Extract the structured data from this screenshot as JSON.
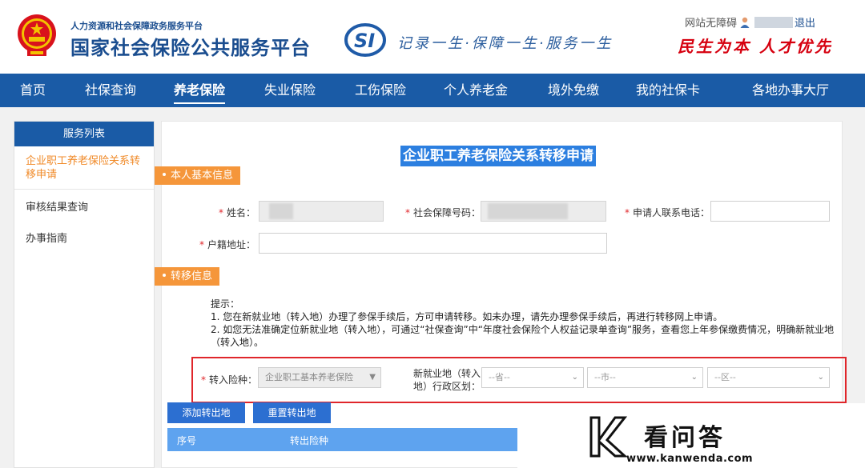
{
  "header": {
    "sub_org": "人力资源和社会保障政务服务平台",
    "site_name": "国家社会保险公共服务平台",
    "si_logo_text": "SI",
    "motto": "记录一生·保障一生·服务一生",
    "accessibility": "网站无障碍",
    "logout": "退出",
    "slogan": "民生为本 人才优先"
  },
  "nav": {
    "items": [
      "首页",
      "社保查询",
      "养老保险",
      "失业保险",
      "工伤保险",
      "个人养老金",
      "境外免缴",
      "我的社保卡",
      "各地办事大厅"
    ],
    "active_index": 2
  },
  "sidebar": {
    "title": "服务列表",
    "items": [
      "企业职工养老保险关系转移申请",
      "审核结果查询",
      "办事指南"
    ]
  },
  "form": {
    "title": "企业职工养老保险关系转移申请",
    "section_basic": "本人基本信息",
    "section_transfer": "转移信息",
    "name_label": "姓名：",
    "ssn_label": "社会保障号码：",
    "phone_label": "申请人联系电话：",
    "address_label": "户籍地址：",
    "tips_title": "提示：",
    "tip1": "1. 您在新就业地（转入地）办理了参保手续后，方可申请转移。如未办理，请先办理参保手续后，再进行转移网上申请。",
    "tip2": "2. 如您无法准确定位新就业地（转入地），可通过“社保查询”中“年度社会保险个人权益记录单查询”服务，查看您上年参保缴费情况，明确新就业地（转入地）。",
    "insurance_type_label": "转入险种：",
    "insurance_type_value": "企业职工基本养老保险",
    "region_label_1": "新就业地（转入",
    "region_label_2": "地）行政区划：",
    "province_placeholder": "--省--",
    "city_placeholder": "--市--",
    "district_placeholder": "--区--",
    "add_button": "添加转出地",
    "reset_button": "重置转出地",
    "table_col_index": "序号",
    "table_col_insurance": "转出险种"
  },
  "watermark": {
    "title": "看问答",
    "url": "www.kanwenda.com"
  },
  "colors": {
    "brand_blue": "#1a5ba6",
    "accent_orange": "#f5963a",
    "title_highlight": "#2c7fe0",
    "required_red": "#e0262b",
    "slogan_red": "#d6000f"
  }
}
